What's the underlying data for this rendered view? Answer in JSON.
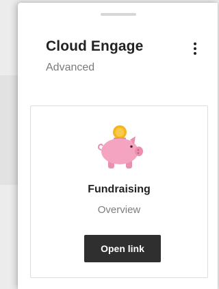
{
  "panel": {
    "title": "Cloud Engage",
    "subtitle": "Advanced"
  },
  "card": {
    "title": "Fundraising",
    "subtitle": "Overview",
    "button_label": "Open link",
    "icon": "piggy-bank-with-coin-icon"
  },
  "colors": {
    "piggy_pink": "#f4a4c0",
    "coin_gold": "#f5b51f",
    "button_dark": "#2f2f2f"
  }
}
